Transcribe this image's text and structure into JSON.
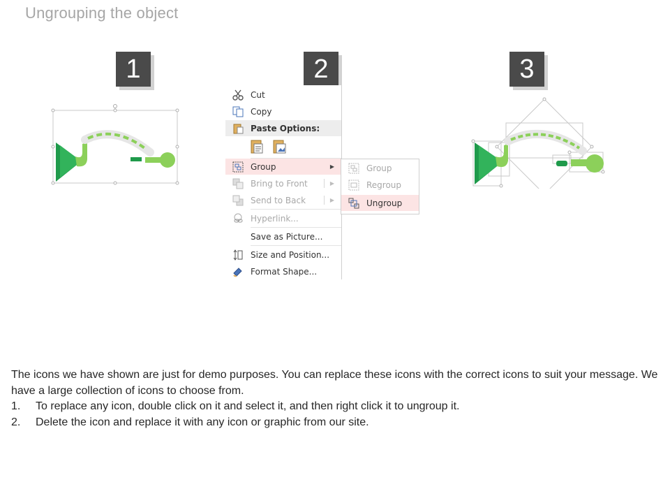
{
  "slide": {
    "title": "Ungrouping the object"
  },
  "steps": [
    {
      "number": "1"
    },
    {
      "number": "2"
    },
    {
      "number": "3"
    }
  ],
  "context_menu": {
    "items": [
      {
        "label": "Cut",
        "icon": "scissors-icon",
        "enabled": true
      },
      {
        "label": "Copy",
        "icon": "copy-icon",
        "enabled": true
      },
      {
        "label": "Paste Options:",
        "icon": "paste-icon",
        "header": true
      },
      {
        "label": "Group",
        "icon": "group-icon",
        "enabled": true,
        "highlighted": true,
        "submenu": true
      },
      {
        "label": "Bring to Front",
        "icon": "bring-to-front-icon",
        "enabled": false,
        "submenu": true
      },
      {
        "label": "Send to Back",
        "icon": "send-to-back-icon",
        "enabled": false,
        "submenu": true
      },
      {
        "label": "Hyperlink...",
        "icon": "hyperlink-icon",
        "enabled": false
      },
      {
        "label": "Save as Picture...",
        "icon": "",
        "enabled": true
      },
      {
        "label": "Size and Position...",
        "icon": "size-position-icon",
        "enabled": true
      },
      {
        "label": "Format Shape...",
        "icon": "format-shape-icon",
        "enabled": true
      }
    ],
    "paste_options": [
      {
        "icon": "paste-keep-text-icon"
      },
      {
        "icon": "paste-picture-icon"
      }
    ]
  },
  "group_submenu": {
    "items": [
      {
        "label": "Group",
        "icon": "group-icon",
        "enabled": false
      },
      {
        "label": "Regroup",
        "icon": "regroup-icon",
        "enabled": false
      },
      {
        "label": "Ungroup",
        "icon": "ungroup-icon",
        "enabled": true,
        "highlighted": true
      }
    ]
  },
  "description": {
    "intro": "The icons we have shown are just for demo purposes. You can replace these icons with the correct icons to suit your message. We have a large collection of icons to choose from.",
    "steps": [
      {
        "num": "1.",
        "text": "To replace any icon, double click on it and select it, and then right click it to ungroup it."
      },
      {
        "num": "2.",
        "text": "Delete the icon and replace it with any icon or graphic from our site."
      }
    ]
  },
  "colors": {
    "badge": "#4a4a4a",
    "badge_shadow": "#d2d2d2",
    "green_dark": "#1f9a4b",
    "green_light": "#8cd05a",
    "menu_highlight": "#fce4e4"
  }
}
